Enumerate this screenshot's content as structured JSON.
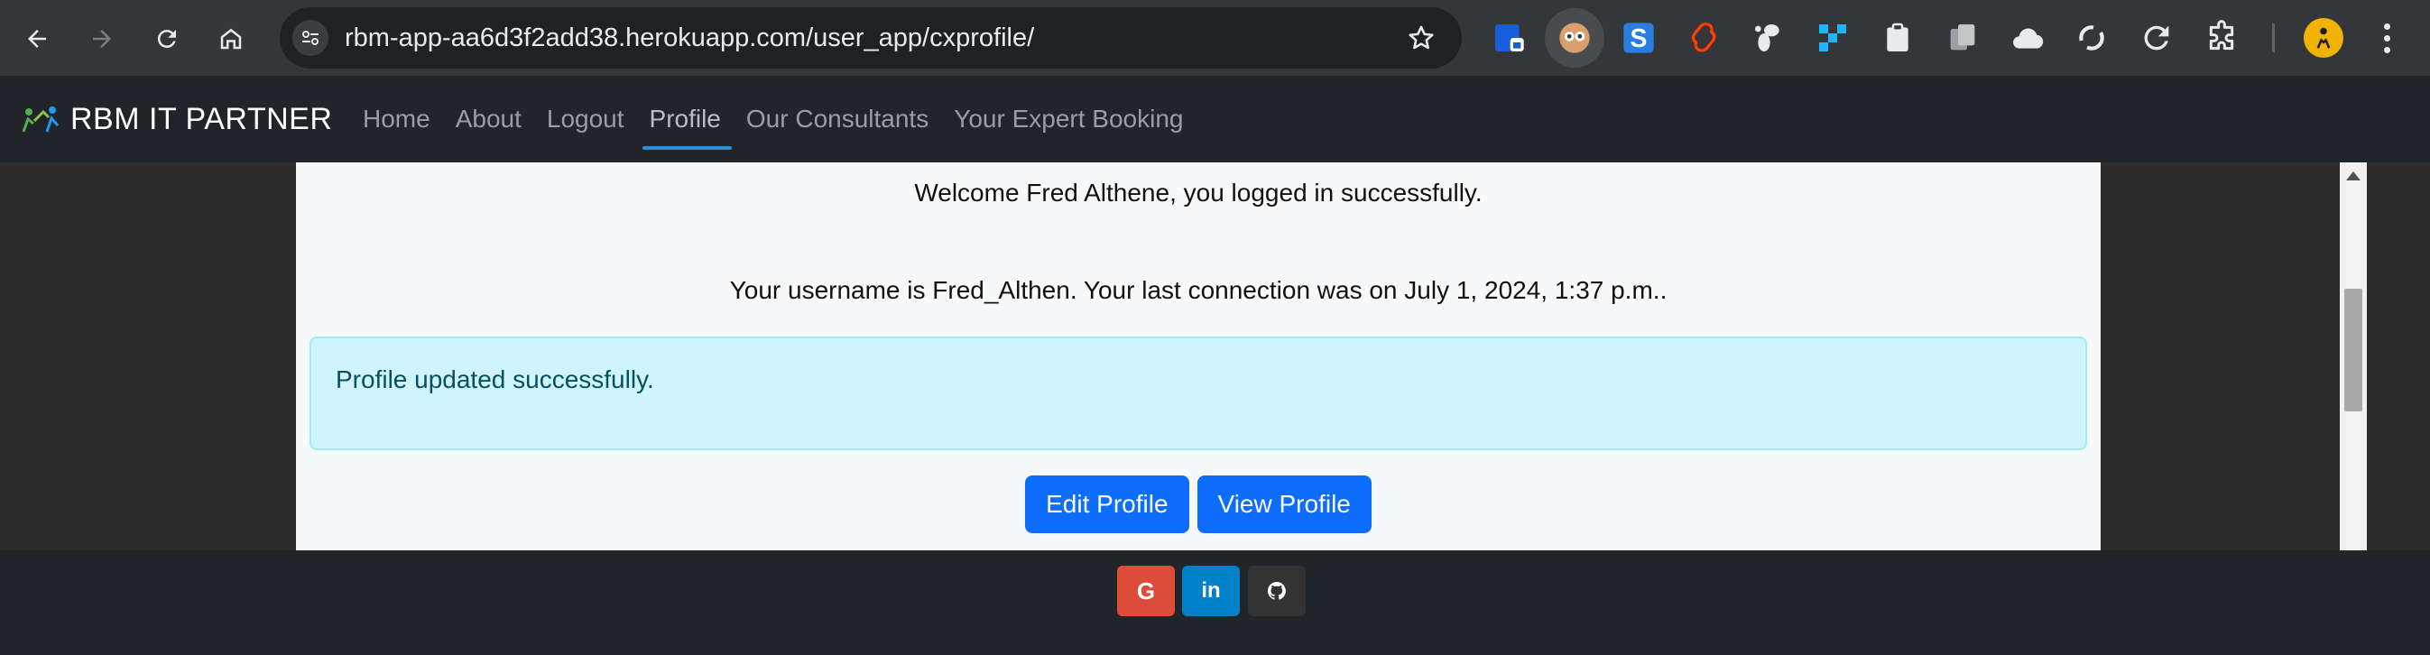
{
  "browser": {
    "url": "rbm-app-aa6d3f2add38.herokuapp.com/user_app/cxprofile/",
    "icons": [
      "back-icon",
      "forward-icon",
      "reload-icon",
      "home-icon",
      "site-settings-icon",
      "bookmark-star-icon",
      "extensions-icon",
      "profile-avatar-icon",
      "menu-icon"
    ]
  },
  "navbar": {
    "brand": "RBM IT PARTNER",
    "links": [
      {
        "label": "Home"
      },
      {
        "label": "About"
      },
      {
        "label": "Logout"
      },
      {
        "label": "Profile"
      },
      {
        "label": "Our Consultants"
      },
      {
        "label": "Your Expert Booking"
      }
    ],
    "active_link": "Profile"
  },
  "main": {
    "welcome_text": "Welcome Fred Althene, you logged in successfully.",
    "user_info_text": "Your username is Fred_Althen. Your last connection was on July 1, 2024, 1:37 p.m..",
    "alert_text": "Profile updated successfully.",
    "buttons": {
      "edit_profile": "Edit Profile",
      "view_profile": "View Profile"
    }
  },
  "footer": {
    "social": [
      {
        "name": "google",
        "glyph": "G",
        "color": "#dd4b39"
      },
      {
        "name": "linkedin",
        "glyph": "in",
        "color": "#0082ca"
      },
      {
        "name": "github",
        "glyph": "",
        "color": "#333333"
      }
    ]
  },
  "colors": {
    "navbar_bg": "#212529",
    "primary_button": "#0d6efd",
    "alert_bg": "#cff4fc",
    "alert_text": "#055160",
    "active_underline": "#2f8fd0"
  }
}
